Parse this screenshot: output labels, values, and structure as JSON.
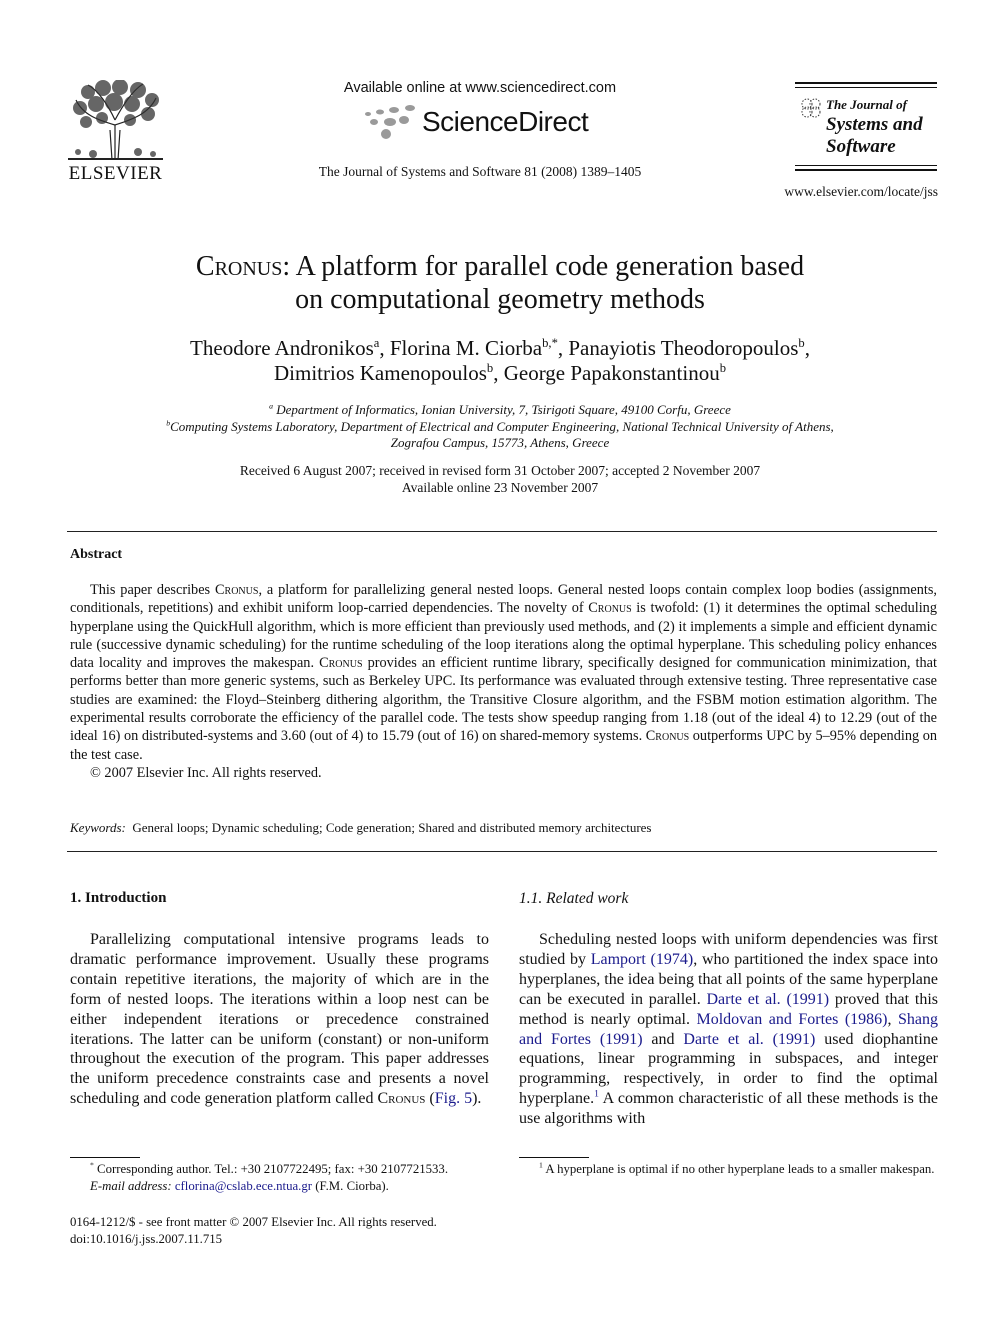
{
  "header": {
    "publisher_word": "ELSEVIER",
    "available_online": "Available online at www.sciencedirect.com",
    "sciencedirect": "ScienceDirect",
    "citation": "The Journal of Systems and Software 81 (2008) 1389–1405",
    "journal_logo": {
      "the": "The Journal of",
      "line1": "Systems and",
      "line2": "Software"
    },
    "journal_url": "www.elsevier.com/locate/jss"
  },
  "article": {
    "title_sc": "Cronus",
    "title_rest": ": A platform for parallel code generation based",
    "title_line2": "on computational geometry methods",
    "authors": [
      {
        "name": "Theodore Andronikos",
        "sup": "a",
        "sep": ", "
      },
      {
        "name": "Florina M. Ciorba",
        "sup": "b,*",
        "sep": ", "
      },
      {
        "name": "Panayiotis Theodoropoulos",
        "sup": "b",
        "sep": ","
      },
      {
        "name": "Dimitrios Kamenopoulos",
        "sup": "b",
        "sep": ", "
      },
      {
        "name": "George Papakonstantinou",
        "sup": "b",
        "sep": ""
      }
    ],
    "affiliations": [
      {
        "mark": "a",
        "text": "Department of Informatics, Ionian University, 7, Tsirigoti Square, 49100 Corfu, Greece"
      },
      {
        "mark": "b",
        "text": "Computing Systems Laboratory, Department of Electrical and Computer Engineering, National Technical University of Athens,",
        "text2": "Zografou Campus, 15773, Athens, Greece"
      }
    ],
    "received": "Received 6 August 2007; received in revised form 31 October 2007; accepted 2 November 2007",
    "available": "Available online 23 November 2007"
  },
  "abstract": {
    "heading": "Abstract",
    "segments": [
      {
        "t": "This paper describes "
      },
      {
        "t": "Cronus",
        "sc": true
      },
      {
        "t": ", a platform for parallelizing general nested loops. General nested loops contain complex loop bodies (assignments, conditionals, repetitions) and exhibit uniform loop-carried dependencies. The novelty of "
      },
      {
        "t": "Cronus",
        "sc": true
      },
      {
        "t": " is twofold: (1) it determines the optimal scheduling hyperplane using the QuickHull algorithm, which is more efficient than previously used methods, and (2) it implements a simple and efficient dynamic rule (successive dynamic scheduling) for the runtime scheduling of the loop iterations along the optimal hyperplane. This scheduling policy enhances data locality and improves the makespan. "
      },
      {
        "t": "Cronus",
        "sc": true
      },
      {
        "t": " provides an efficient runtime library, specifically designed for communication minimization, that performs better than more generic systems, such as Berkeley UPC. Its performance was evaluated through extensive testing. Three representative case studies are examined: the Floyd–Steinberg dithering algorithm, the Transitive Closure algorithm, and the FSBM motion estimation algorithm. The experimental results corroborate the efficiency of the parallel code. The tests show speedup ranging from 1.18 (out of the ideal 4) to 12.29 (out of the ideal 16) on distributed-systems and 3.60 (out of 4) to 15.79 (out of 16) on shared-memory systems. "
      },
      {
        "t": "Cronus",
        "sc": true
      },
      {
        "t": " outperforms UPC by 5–95% depending on the test case."
      }
    ],
    "copyright": "© 2007 Elsevier Inc. All rights reserved."
  },
  "keywords": {
    "label": "Keywords:",
    "text": "General loops; Dynamic scheduling; Code generation; Shared and distributed memory architectures"
  },
  "intro": {
    "heading": "1. Introduction",
    "body_pre": "Parallelizing computational intensive programs leads to dramatic performance improvement. Usually these programs contain repetitive iterations, the majority of which are in the form of nested loops. The iterations within a loop nest can be either independent iterations or precedence constrained iterations. The latter can be uniform (constant) or non-uniform throughout the execution of the program. This paper addresses the uniform precedence constraints case and presents a novel scheduling and code generation platform called ",
    "body_sc": "Cronus",
    "body_mid": " (",
    "fig_link": "Fig. 5",
    "body_post": ")."
  },
  "related": {
    "heading": "1.1. Related work",
    "segments": [
      {
        "t": "Scheduling nested loops with uniform dependencies was first studied by "
      },
      {
        "t": "Lamport (1974)",
        "link": true
      },
      {
        "t": ", who partitioned the index space into hyperplanes, the idea being that all points of the same hyperplane can be executed in parallel. "
      },
      {
        "t": "Darte et al. (1991)",
        "link": true
      },
      {
        "t": " proved that this method is nearly optimal. "
      },
      {
        "t": "Moldovan and Fortes (1986)",
        "link": true
      },
      {
        "t": ", "
      },
      {
        "t": "Shang and Fortes (1991)",
        "link": true
      },
      {
        "t": " and "
      },
      {
        "t": "Darte et al. (1991)",
        "link": true
      },
      {
        "t": " used diophantine equations, linear programming in subspaces, and integer programming, respectively, in order to find the optimal hyperplane."
      },
      {
        "t": "1",
        "sup": true
      },
      {
        "t": " A common characteristic of all these methods is the use algorithms with"
      }
    ]
  },
  "footnotes": {
    "corresponding_mark": "*",
    "corresponding": "Corresponding author. Tel.: +30 2107722495; fax: +30 2107721533.",
    "email_label": "E-mail address:",
    "email": "cflorina@cslab.ece.ntua.gr",
    "email_owner": " (F.M. Ciorba).",
    "fn1_mark": "1",
    "fn1": "A hyperplane is optimal if no other hyperplane leads to a smaller makespan.",
    "issn": "0164-1212/$ - see front matter © 2007 Elsevier Inc. All rights reserved.",
    "doi": "doi:10.1016/j.jss.2007.11.715"
  },
  "colors": {
    "link": "#1a1a8c",
    "text": "#111111",
    "logo_gray": "#9a9a9a"
  }
}
